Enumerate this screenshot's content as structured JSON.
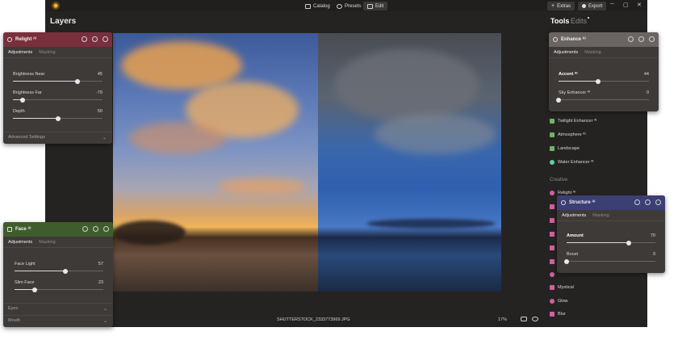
{
  "topbar": {
    "tabs": [
      {
        "label": "Catalog",
        "active": false
      },
      {
        "label": "Presets",
        "active": false
      },
      {
        "label": "Edit",
        "active": true
      }
    ],
    "extras_label": "Extras",
    "export_label": "Export"
  },
  "layers_title": "Layers",
  "tools_title": "Tools",
  "edits_title": "Edits",
  "status": {
    "filename": "SHUTTERSTOCK_2333773969.JPG",
    "zoom": "17%"
  },
  "tools_list": [
    {
      "label": "Twilight Enhancer ᴬᴵ",
      "icon": "twilight-icon",
      "color": "#6fb36a"
    },
    {
      "label": "Atmosphere ᴬᴵ",
      "icon": "atmosphere-icon",
      "color": "#6fb36a"
    },
    {
      "label": "Landscape",
      "icon": "landscape-icon",
      "color": "#6fb36a"
    },
    {
      "label": "Water Enhancer ᴬᴵ",
      "icon": "water-icon",
      "color": "#5ad0a8"
    }
  ],
  "creative_label": "Creative",
  "creative_list": [
    {
      "label": "Relight ᴬᴵ",
      "icon": "relight-icon",
      "color": "#d060a0"
    },
    {
      "label": "Mystical",
      "icon": "mystical-icon",
      "color": "#d060a0"
    },
    {
      "label": "Glow",
      "icon": "glow-icon",
      "color": "#d060a0"
    },
    {
      "label": "Blur",
      "icon": "blur-icon",
      "color": "#d060a0"
    }
  ],
  "relight_panel": {
    "title": "Relight ᴬᴵ",
    "tab_active": "Adjustments",
    "tab_other": "Masking",
    "sliders": [
      {
        "label": "Brightness Near",
        "value": "45",
        "fraction": 0.725
      },
      {
        "label": "Brightness Far",
        "value": "-79",
        "fraction": 0.105
      },
      {
        "label": "Depth",
        "value": "50",
        "fraction": 0.5
      }
    ],
    "collapsed": "Advanced Settings",
    "color": "#7a2f3c"
  },
  "face_panel": {
    "title": "Face ᴬᴵ",
    "tab_active": "Adjustments",
    "tab_other": "Masking",
    "sliders": [
      {
        "label": "Face Light",
        "value": "57",
        "fraction": 0.57
      },
      {
        "label": "Slim Face",
        "value": "23",
        "fraction": 0.23
      }
    ],
    "collapsed": [
      "Eyes",
      "Mouth"
    ],
    "color": "#3f5d2c"
  },
  "enhance_panel": {
    "title": "Enhance ᴬᴵ",
    "tab_active": "Adjustments",
    "tab_other": "Masking",
    "sliders": [
      {
        "label": "Accent ᴬᴵ",
        "value": "44",
        "fraction": 0.44
      },
      {
        "label": "Sky Enhancer ᴬᴵ",
        "value": "0",
        "fraction": 0.0
      }
    ],
    "color": "#6a6562"
  },
  "structure_panel": {
    "title": "Structure ᴬᴵ",
    "tab_active": "Adjustments",
    "tab_other": "Masking",
    "sliders": [
      {
        "label": "Amount",
        "value": "70",
        "fraction": 0.7
      },
      {
        "label": "Boost",
        "value": "0",
        "fraction": 0.0
      }
    ],
    "color": "#3c3f74"
  }
}
